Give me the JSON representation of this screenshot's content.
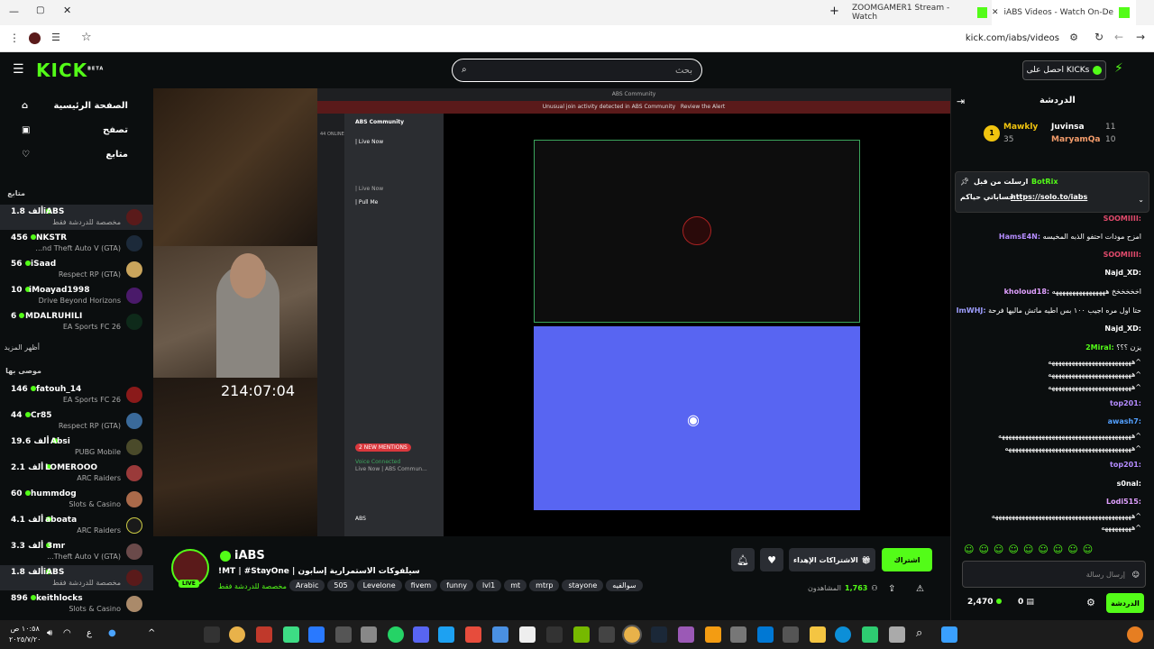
{
  "browser": {
    "tabs": [
      {
        "label": "ZOOMGAMER1 Stream - Watch"
      },
      {
        "label": "iABS Videos - Watch On-De"
      }
    ],
    "url": "kick.com/iabs/videos"
  },
  "header": {
    "logo": "KICK",
    "logo_beta": "BETA",
    "search_placeholder": "بحث",
    "get_kicks": "احصل على KICKs"
  },
  "sidebar": {
    "nav": [
      {
        "label": "الصفحة الرئيسية",
        "icon": "home-icon"
      },
      {
        "label": "تصفح",
        "icon": "browse-icon"
      },
      {
        "label": "متابع",
        "icon": "heart-icon"
      }
    ],
    "following_title": "متابع",
    "following": [
      {
        "name": "iABS",
        "viewers": "1.8 ألف",
        "sub": "مخصصة للدردشة فقط",
        "active": true
      },
      {
        "name": "NKSTR",
        "viewers": "456",
        "sub": "...nd Theft Auto V (GTA)"
      },
      {
        "name": "iSaad",
        "viewers": "56",
        "sub": "Respect RP (GTA)"
      },
      {
        "name": "iMoayad1998",
        "viewers": "10",
        "sub": "Drive Beyond Horizons"
      },
      {
        "name": "MDALRUHILI",
        "viewers": "6",
        "sub": "EA Sports FC 26"
      }
    ],
    "show_more": "أظهر المزيد",
    "recommended_title": "موصى بها",
    "recommended": [
      {
        "name": "fatouh_14",
        "viewers": "146",
        "sub": "EA Sports FC 26"
      },
      {
        "name": "Cr85",
        "viewers": "44",
        "sub": "Respect RP (GTA)"
      },
      {
        "name": "Absi",
        "viewers": "19.6 ألف",
        "sub": "PUBG Mobile"
      },
      {
        "name": "LOMEROOO",
        "viewers": "2.1 ألف",
        "sub": "ARC Raiders"
      },
      {
        "name": "hummdog",
        "viewers": "60",
        "sub": "Slots & Casino"
      },
      {
        "name": "aboata",
        "viewers": "4.1 ألف",
        "sub": "ARC Raiders"
      },
      {
        "name": "3mr",
        "viewers": "3.3 ألف",
        "sub": "...Theft Auto V (GTA)"
      },
      {
        "name": "iABS",
        "viewers": "1.8 ألف",
        "sub": "مخصصة للدردشة فقط",
        "active": true
      },
      {
        "name": "keithlocks",
        "viewers": "896",
        "sub": "Slots & Casino"
      }
    ]
  },
  "video": {
    "timer": "214:07:04",
    "discord_title": "ABS Community",
    "discord_alert": "Unusual join activity detected in ABS Community",
    "discord_alert_link": "Review the Alert",
    "discord_server": "ABS Community",
    "discord_online": "44 ONLINE",
    "discord_channels": [
      "| Live Now",
      "| Live Now",
      "| Pull Me"
    ],
    "voice_connected": "Voice Connected",
    "voice_channel": "Live Now | ABS Commun...",
    "new_mentions": "2 NEW MENTIONS",
    "discord_user": "ABS"
  },
  "stream": {
    "streamer": "iABS",
    "live_badge": "LIVE",
    "title": "!MT | #StayOne | سيلفوكات الاستمرارية إسابون",
    "category": "مخصصة للدردشة فقط",
    "tags": [
      "Arabic",
      "505",
      "Levelone",
      "fivem",
      "funny",
      "lvl1",
      "mt",
      "mtrp",
      "stayone",
      "سوالفيه"
    ],
    "follow_btn": "اشتراك",
    "gift_btn": "الاشتراكات الإهداء",
    "viewers_label": "المشاهدون",
    "viewers": "1,763"
  },
  "chat": {
    "title": "الدردشة",
    "leaders": [
      {
        "rank": "1",
        "name": "Mawkly",
        "value": "35"
      },
      {
        "name": "Juvinsa",
        "value": "11"
      },
      {
        "name": "MaryamQa",
        "value": "10"
      }
    ],
    "pinned_by_label": "ارسلت من قبل",
    "pinned_user": "BotRix",
    "pinned_text": "حساباتي حياكم :",
    "pinned_link": "https://solo.to/iabs",
    "messages": [
      {
        "user": "SOOMIIII:",
        "text": "",
        "color": "#e04a6b"
      },
      {
        "user": "HamsE4N:",
        "text": "امزح مودات احتفو الذبه المخيسه",
        "color": "#b58cff"
      },
      {
        "user": "SOOMIIII:",
        "text": "",
        "color": "#e04a6b"
      },
      {
        "user": "Najd_XD:",
        "text": "",
        "color": "#fff"
      },
      {
        "user": "kholoud18:",
        "text": "اخخخخخخ ههههههههههههههههه",
        "color": "#e0a0ff"
      },
      {
        "user": "ImWHJ:",
        "text": "حتا اول مره اجيب ١٠٠ بس اطيه ماتش ماليها فرحة",
        "color": "#9e9eff"
      },
      {
        "user": "Najd_XD:",
        "text": "",
        "color": "#fff"
      },
      {
        "user": "2Miral:",
        "text": "يزن ؟؟؟",
        "color": "#53fc18"
      },
      {
        "user": "",
        "text": "هههههههههههههههههههههههههه^",
        "color": "#fff"
      },
      {
        "user": "",
        "text": "هههههههههههههههههههههههههه^",
        "color": "#fff"
      },
      {
        "user": "",
        "text": "هههههههههههههههههههههههههه^",
        "color": "#fff"
      },
      {
        "user": "top201:",
        "text": "",
        "color": "#b58cff"
      },
      {
        "user": "awash7:",
        "text": "",
        "color": "#53a0ff"
      },
      {
        "user": "",
        "text": "ههههههههههههههههههههههههههههههههههههههههه^",
        "color": "#fff"
      },
      {
        "user": "",
        "text": "ههههههههههههههههههههههههههههههههههههههه^",
        "color": "#fff"
      },
      {
        "user": "top201:",
        "text": "",
        "color": "#b58cff"
      },
      {
        "user": "s0nal:",
        "text": "",
        "color": "#fff"
      },
      {
        "user": "Lodi515:",
        "text": "",
        "color": "#e0a0ff"
      },
      {
        "user": "",
        "text": "ههههههههههههههههههههههههههههههههههههههههههه^",
        "color": "#fff"
      },
      {
        "user": "",
        "text": "هههههههههه^",
        "color": "#fff"
      }
    ],
    "input_placeholder": "إرسال رسالة",
    "points": "2,470",
    "kicks": "0",
    "send_btn": "الدردشة"
  },
  "taskbar": {
    "time": "١٠:٥٨ ص",
    "date": "٢٠٢٥/٧/٢٠",
    "lang": "ع"
  },
  "colors": {
    "kick_green": "#53fc18",
    "discord_blurple": "#5865f2"
  }
}
